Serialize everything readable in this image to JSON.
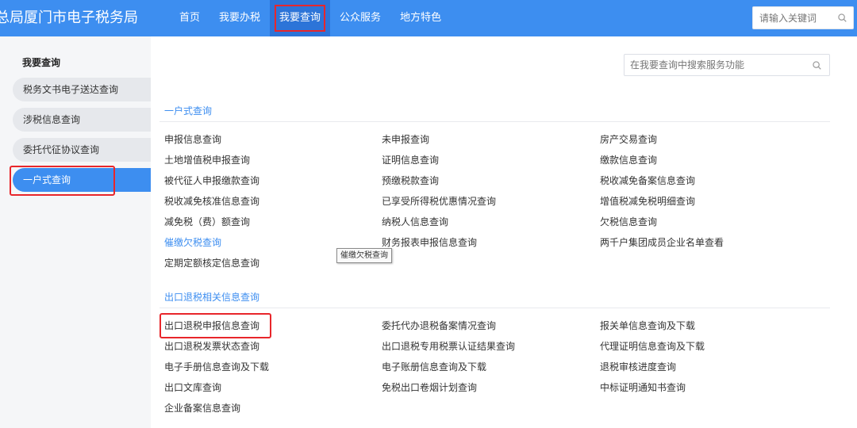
{
  "header": {
    "site_title": "总局厦门市电子税务局",
    "nav": [
      "首页",
      "我要办税",
      "我要查询",
      "公众服务",
      "地方特色"
    ],
    "search_placeholder": "请输入关键词"
  },
  "sidebar": {
    "title": "我要查询",
    "items": [
      "税务文书电子送达查询",
      "涉税信息查询",
      "委托代征协议查询",
      "一户式查询"
    ],
    "active": "一户式查询"
  },
  "main": {
    "search_placeholder": "在我要查询中搜索服务功能",
    "sections": [
      {
        "title": "一户式查询",
        "links": [
          "申报信息查询",
          "未申报查询",
          "房产交易查询",
          "土地增值税申报查询",
          "证明信息查询",
          "缴款信息查询",
          "被代征人申报缴款查询",
          "预缴税款查询",
          "税收减免备案信息查询",
          "税收减免核准信息查询",
          "已享受所得税优惠情况查询",
          "增值税减免税明细查询",
          "减免税（费）额查询",
          "纳税人信息查询",
          "欠税信息查询",
          "催缴欠税查询",
          "财务报表申报信息查询",
          "两千户集团成员企业名单查看",
          "定期定额核定信息查询"
        ],
        "hovered": "催缴欠税查询"
      },
      {
        "title": "出口退税相关信息查询",
        "links": [
          "出口退税申报信息查询",
          "委托代办退税备案情况查询",
          "报关单信息查询及下载",
          "出口退税发票状态查询",
          "出口退税专用税票认证结果查询",
          "代理证明信息查询及下载",
          "电子手册信息查询及下载",
          "电子账册信息查询及下载",
          "退税审核进度查询",
          "出口文库查询",
          "免税出口卷烟计划查询",
          "中标证明通知书查询",
          "企业备案信息查询"
        ]
      }
    ],
    "tooltip": "催缴欠税查询"
  },
  "colors": {
    "brand_blue": "#3d8ef0",
    "highlight_red": "#e8262b"
  },
  "icons": {
    "search": "search-icon"
  }
}
